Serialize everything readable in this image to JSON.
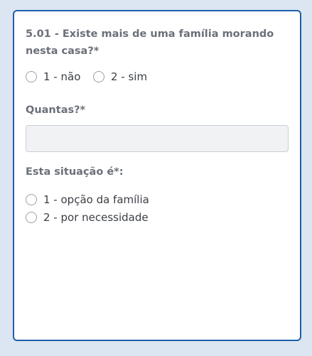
{
  "question_1": {
    "title": "5.01 - Existe mais de uma família morando nesta casa?*",
    "options": [
      {
        "label": "1 - não",
        "selected": false
      },
      {
        "label": "2 - sim",
        "selected": false
      }
    ]
  },
  "quantity": {
    "label": "Quantas?*",
    "value": "",
    "placeholder": ""
  },
  "question_2": {
    "title": "Esta situação é*:",
    "options": [
      {
        "label": "1 - opção da família",
        "selected": false
      },
      {
        "label": "2 - por necessidade",
        "selected": false
      }
    ]
  },
  "colors": {
    "page_background": "#dbe6f2",
    "card_border": "#1f5fa8",
    "label_text": "#6b7079",
    "input_background": "#f1f2f4"
  }
}
